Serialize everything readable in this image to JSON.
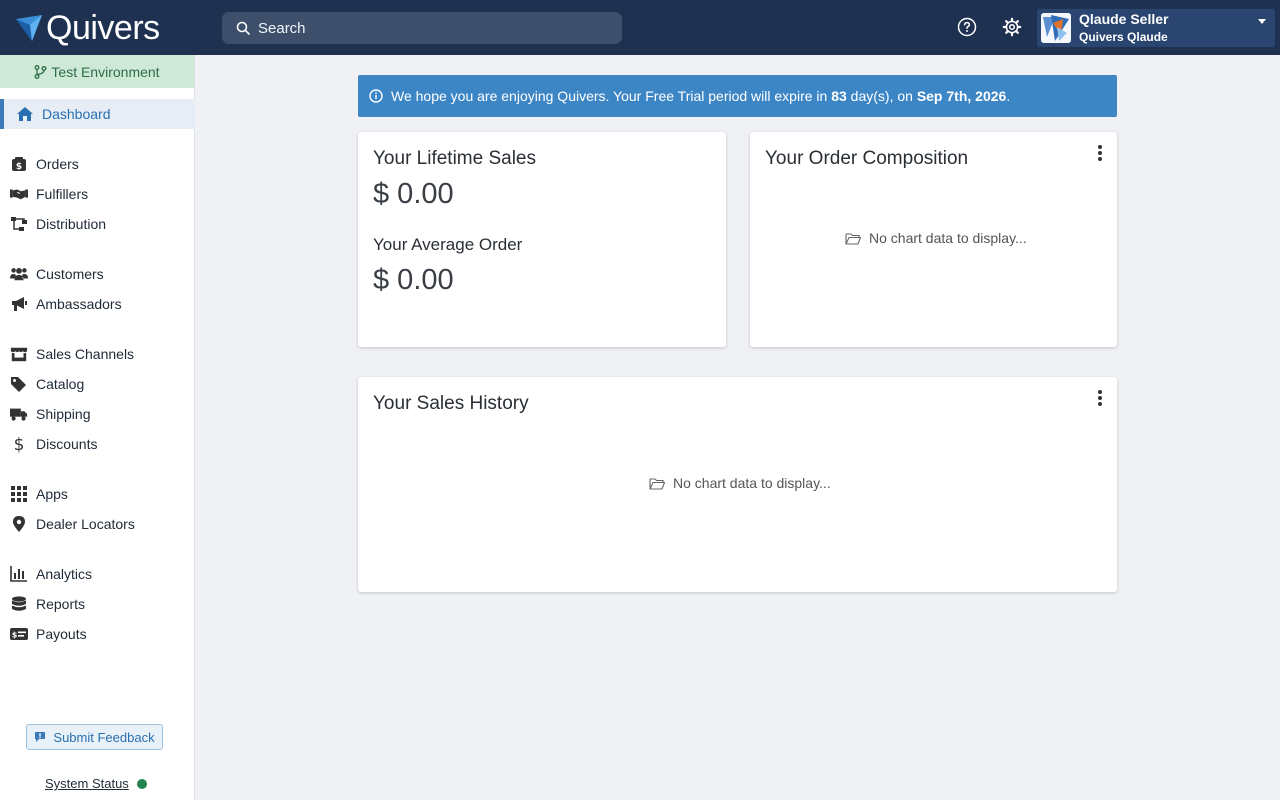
{
  "brand": {
    "name": "Quivers"
  },
  "search": {
    "placeholder": "Search"
  },
  "user": {
    "name": "Qlaude Seller",
    "org": "Quivers Qlaude"
  },
  "sidebar": {
    "environment": "Test Environment",
    "items": [
      {
        "label": "Dashboard",
        "icon": "home-icon",
        "active": true
      },
      {
        "label": "Orders",
        "icon": "orders-icon"
      },
      {
        "label": "Fulfillers",
        "icon": "handshake-icon"
      },
      {
        "label": "Distribution",
        "icon": "distribution-icon"
      },
      {
        "label": "Customers",
        "icon": "users-icon"
      },
      {
        "label": "Ambassadors",
        "icon": "megaphone-icon"
      },
      {
        "label": "Sales Channels",
        "icon": "store-icon"
      },
      {
        "label": "Catalog",
        "icon": "tags-icon"
      },
      {
        "label": "Shipping",
        "icon": "truck-icon"
      },
      {
        "label": "Discounts",
        "icon": "dollar-icon"
      },
      {
        "label": "Apps",
        "icon": "grid-icon"
      },
      {
        "label": "Dealer Locators",
        "icon": "map-pin-icon"
      },
      {
        "label": "Analytics",
        "icon": "bar-chart-icon"
      },
      {
        "label": "Reports",
        "icon": "database-icon"
      },
      {
        "label": "Payouts",
        "icon": "money-check-icon"
      }
    ],
    "feedback_label": "Submit Feedback",
    "status_label": "System Status"
  },
  "banner": {
    "text_before": "We hope you are enjoying Quivers. Your Free Trial period will expire in ",
    "days": "83",
    "text_middle": " day(s), on ",
    "date": "Sep 7th, 2026",
    "text_after": "."
  },
  "lifetime": {
    "title": "Your Lifetime Sales",
    "value": "$ 0.00",
    "avg_title": "Your Average Order",
    "avg_value": "$ 0.00"
  },
  "composition": {
    "title": "Your Order Composition",
    "empty": "No chart data to display..."
  },
  "history": {
    "title": "Your Sales History",
    "empty": "No chart data to display..."
  },
  "colors": {
    "topbar": "#1e3150",
    "accent": "#3d86c6",
    "env_bg": "#cfe9d8",
    "status_ok": "#23834e"
  }
}
